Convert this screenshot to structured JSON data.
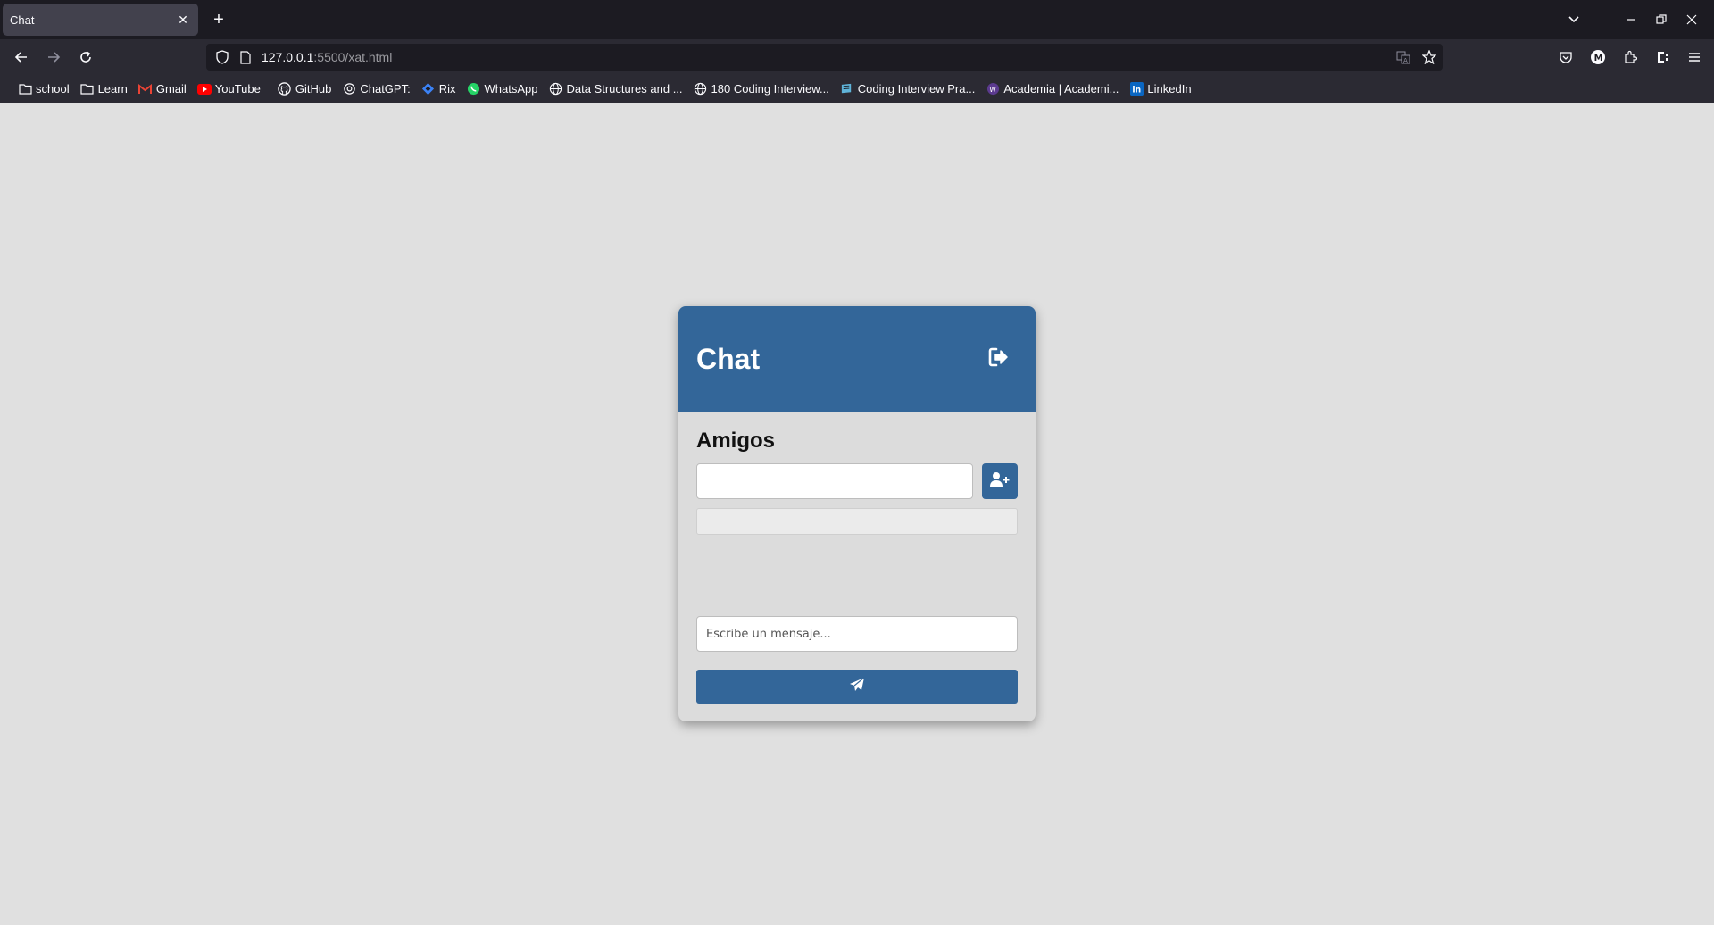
{
  "browser": {
    "tab": {
      "title": "Chat"
    },
    "url": {
      "host": "127.0.0.1",
      "path": ":5500/xat.html"
    },
    "bookmarks": [
      {
        "label": "school",
        "icon": "folder-icon"
      },
      {
        "label": "Learn",
        "icon": "folder-icon"
      },
      {
        "label": "Gmail",
        "icon": "gmail-icon"
      },
      {
        "label": "YouTube",
        "icon": "youtube-icon"
      },
      {
        "label": "GitHub",
        "icon": "github-icon"
      },
      {
        "label": "ChatGPT:",
        "icon": "chatgpt-icon"
      },
      {
        "label": "Rix",
        "icon": "rix-icon"
      },
      {
        "label": "WhatsApp",
        "icon": "whatsapp-icon"
      },
      {
        "label": "Data Structures and ...",
        "icon": "globe-icon"
      },
      {
        "label": "180 Coding Interview...",
        "icon": "globe-icon"
      },
      {
        "label": "Coding Interview Pra...",
        "icon": "book-icon"
      },
      {
        "label": "Academia | Academi...",
        "icon": "academia-icon"
      },
      {
        "label": "LinkedIn",
        "icon": "linkedin-icon"
      }
    ]
  },
  "app": {
    "header": {
      "title": "Chat",
      "logout_icon": "logout-icon"
    },
    "friends": {
      "title": "Amigos",
      "input_value": "",
      "add_icon": "user-plus-icon"
    },
    "message": {
      "placeholder": "Escribe un mensaje...",
      "send_icon": "paper-plane-icon"
    }
  },
  "colors": {
    "primary": "#336699",
    "page_bg": "#e0e0e0",
    "card_bg": "#dcdcdc"
  }
}
